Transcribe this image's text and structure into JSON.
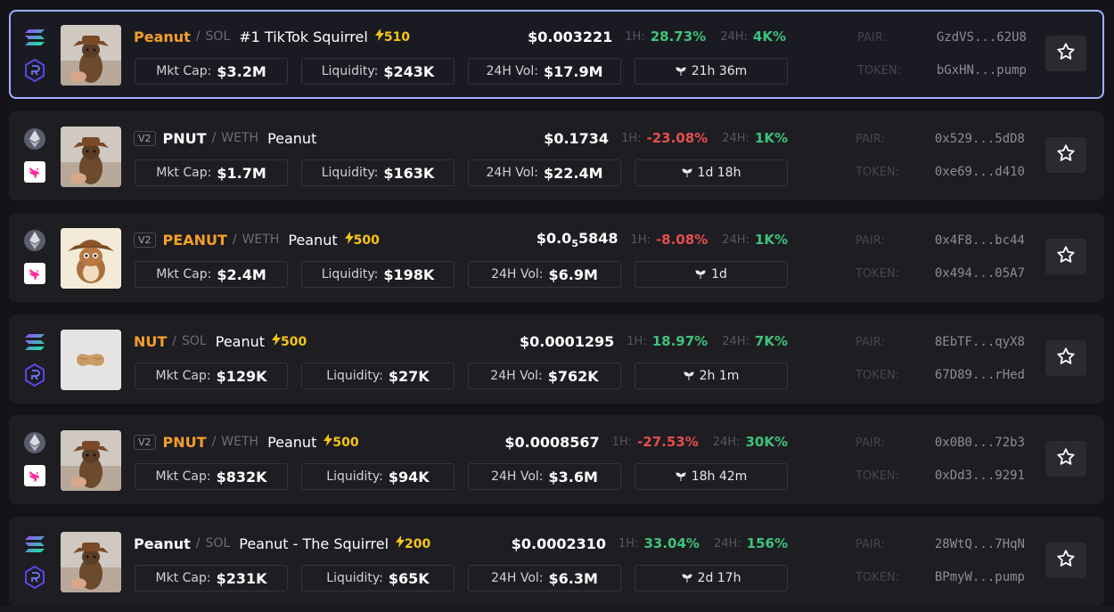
{
  "rows": [
    {
      "version": "",
      "symbol": "Peanut",
      "symbol_color": "#f59e2a",
      "quote": "SOL",
      "name": "#1 TikTok Squirrel",
      "boost": "510",
      "chain": "solana",
      "dex": "raydium",
      "price": "$0.003221",
      "h1_label": "1H:",
      "h1": "28.73%",
      "h1_dir": "up",
      "h24_label": "24H:",
      "h24": "4K%",
      "h24_dir": "up",
      "mktcap_label": "Mkt Cap:",
      "mktcap": "$3.2M",
      "liq_label": "Liquidity:",
      "liq": "$243K",
      "vol_label": "24H Vol:",
      "vol": "$17.9M",
      "age": "21h 36m",
      "pair_label": "PAIR:",
      "pair": "GzdVS...62U8",
      "token_label": "TOKEN:",
      "token": "bGxHN...pump",
      "avatar": "squirrel-hat",
      "selected": true
    },
    {
      "version": "V2",
      "symbol": "PNUT",
      "symbol_color": "#ffffff",
      "quote": "WETH",
      "name": "Peanut",
      "boost": "",
      "chain": "ethereum",
      "dex": "uniswap",
      "price": "$0.1734",
      "h1_label": "1H:",
      "h1": "-23.08%",
      "h1_dir": "down",
      "h24_label": "24H:",
      "h24": "1K%",
      "h24_dir": "up",
      "mktcap_label": "Mkt Cap:",
      "mktcap": "$1.7M",
      "liq_label": "Liquidity:",
      "liq": "$163K",
      "vol_label": "24H Vol:",
      "vol": "$22.4M",
      "age": "1d 18h",
      "pair_label": "PAIR:",
      "pair": "0x529...5dD8",
      "token_label": "TOKEN:",
      "token": "0xe69...d410",
      "avatar": "squirrel-hat",
      "selected": false
    },
    {
      "version": "V2",
      "symbol": "PEANUT",
      "symbol_color": "#f59e2a",
      "quote": "WETH",
      "name": "Peanut",
      "boost": "500",
      "chain": "ethereum",
      "dex": "uniswap",
      "price_prefix": "$0.0",
      "price_sub": "5",
      "price_suffix": "5848",
      "h1_label": "1H:",
      "h1": "-8.08%",
      "h1_dir": "down",
      "h24_label": "24H:",
      "h24": "1K%",
      "h24_dir": "up",
      "mktcap_label": "Mkt Cap:",
      "mktcap": "$2.4M",
      "liq_label": "Liquidity:",
      "liq": "$198K",
      "vol_label": "24H Vol:",
      "vol": "$6.9M",
      "age": "1d",
      "pair_label": "PAIR:",
      "pair": "0x4F8...bc44",
      "token_label": "TOKEN:",
      "token": "0x494...05A7",
      "avatar": "squirrel-cartoon",
      "selected": false
    },
    {
      "version": "",
      "symbol": "NUT",
      "symbol_color": "#f59e2a",
      "quote": "SOL",
      "name": "Peanut",
      "boost": "500",
      "chain": "solana",
      "dex": "raydium",
      "price": "$0.0001295",
      "h1_label": "1H:",
      "h1": "18.97%",
      "h1_dir": "up",
      "h24_label": "24H:",
      "h24": "7K%",
      "h24_dir": "up",
      "mktcap_label": "Mkt Cap:",
      "mktcap": "$129K",
      "liq_label": "Liquidity:",
      "liq": "$27K",
      "vol_label": "24H Vol:",
      "vol": "$762K",
      "age": "2h 1m",
      "pair_label": "PAIR:",
      "pair": "8EbTF...qyX8",
      "token_label": "TOKEN:",
      "token": "67D89...rHed",
      "avatar": "peanut-shell",
      "selected": false
    },
    {
      "version": "V2",
      "symbol": "PNUT",
      "symbol_color": "#f59e2a",
      "quote": "WETH",
      "name": "Peanut",
      "boost": "500",
      "chain": "ethereum",
      "dex": "uniswap",
      "price": "$0.0008567",
      "h1_label": "1H:",
      "h1": "-27.53%",
      "h1_dir": "down",
      "h24_label": "24H:",
      "h24": "30K%",
      "h24_dir": "up",
      "mktcap_label": "Mkt Cap:",
      "mktcap": "$832K",
      "liq_label": "Liquidity:",
      "liq": "$94K",
      "vol_label": "24H Vol:",
      "vol": "$3.6M",
      "age": "18h 42m",
      "pair_label": "PAIR:",
      "pair": "0x0B0...72b3",
      "token_label": "TOKEN:",
      "token": "0xDd3...9291",
      "avatar": "squirrel-hat",
      "selected": false
    },
    {
      "version": "",
      "symbol": "Peanut",
      "symbol_color": "#ffffff",
      "quote": "SOL",
      "name": "Peanut - The Squirrel",
      "boost": "200",
      "chain": "solana",
      "dex": "raydium",
      "price": "$0.0002310",
      "h1_label": "1H:",
      "h1": "33.04%",
      "h1_dir": "up",
      "h24_label": "24H:",
      "h24": "156%",
      "h24_dir": "up",
      "mktcap_label": "Mkt Cap:",
      "mktcap": "$231K",
      "liq_label": "Liquidity:",
      "liq": "$65K",
      "vol_label": "24H Vol:",
      "vol": "$6.3M",
      "age": "2d 17h",
      "pair_label": "PAIR:",
      "pair": "28WtQ...7HqN",
      "token_label": "TOKEN:",
      "token": "BPmyW...pump",
      "avatar": "squirrel-hat",
      "selected": false
    }
  ],
  "colors": {
    "up": "#3ec27a",
    "down": "#e54e4e",
    "boost": "#f5c518",
    "accent_border": "#9fb0ff"
  }
}
